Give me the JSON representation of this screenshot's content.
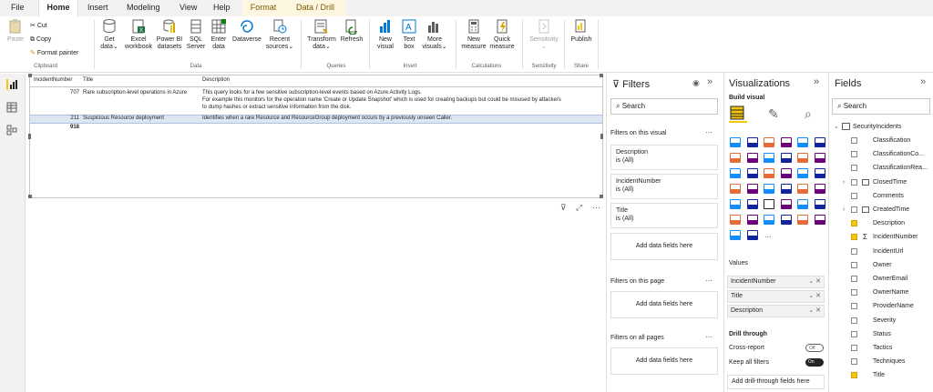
{
  "menu": {
    "file": "File",
    "home": "Home",
    "insert": "Insert",
    "modeling": "Modeling",
    "view": "View",
    "help": "Help",
    "format": "Format",
    "data_drill": "Data / Drill"
  },
  "ribbon": {
    "paste": "Paste",
    "cut": "Cut",
    "copy": "Copy",
    "format_painter": "Format painter",
    "clipboard": "Clipboard",
    "get_data_1": "Get",
    "get_data_2": "data",
    "excel_1": "Excel",
    "excel_2": "workbook",
    "pbi_1": "Power BI",
    "pbi_2": "datasets",
    "sql_1": "SQL",
    "sql_2": "Server",
    "enter_1": "Enter",
    "enter_2": "data",
    "dataverse": "Dataverse",
    "recent_1": "Recent",
    "recent_2": "sources",
    "data_group": "Data",
    "transform_1": "Transform",
    "transform_2": "data",
    "refresh": "Refresh",
    "queries": "Queries",
    "newvisual_1": "New",
    "newvisual_2": "visual",
    "textbox_1": "Text",
    "textbox_2": "box",
    "more_1": "More",
    "more_2": "visuals",
    "insert_group": "Insert",
    "newmeasure_1": "New",
    "newmeasure_2": "measure",
    "quick_1": "Quick",
    "quick_2": "measure",
    "calc_group": "Calculations",
    "sensitivity": "Sensitivity",
    "sensitivity_group": "Sensitivity",
    "publish": "Publish",
    "share": "Share"
  },
  "table": {
    "headers": [
      "IncidentNumber",
      "Title",
      "Description"
    ],
    "rows": [
      {
        "num": "707",
        "title": "Rare subscription-level operations in Azure",
        "desc1": "This query looks for a few sensitive subscription-level events based on Azure Activity Logs.",
        "desc2": "For example this monitors for the operation name 'Create or Update Snapshot' which is used for creating backups but could be misused by attackers",
        "desc3": "to dump hashes or extract sensitive information from the disk."
      },
      {
        "num": "211",
        "title": "Suspicious Resource deployment",
        "desc1": "Identifies when a rare Resource and ResourceGroup deployment occurs by a previously unseen Caller."
      }
    ],
    "total": "918"
  },
  "filters": {
    "title": "Filters",
    "search": "Search",
    "on_visual": "Filters on this visual",
    "cards": [
      {
        "name": "Description",
        "value": "is (All)"
      },
      {
        "name": "IncidentNumber",
        "value": "is (All)"
      },
      {
        "name": "Title",
        "value": "is (All)"
      }
    ],
    "add": "Add data fields here",
    "on_page": "Filters on this page",
    "on_all": "Filters on all pages"
  },
  "viz": {
    "title": "Visualizations",
    "build": "Build visual",
    "values": "Values",
    "wells": [
      "IncidentNumber",
      "Title",
      "Description"
    ],
    "drill": "Drill through",
    "cross": "Cross-report",
    "cross_state": "Off",
    "keep": "Keep all filters",
    "keep_state": "On",
    "add_drill": "Add drill-through fields here",
    "more": "..."
  },
  "fields": {
    "title": "Fields",
    "search": "Search",
    "table": "SecurityIncidents",
    "items": [
      {
        "name": "Classification",
        "checked": false
      },
      {
        "name": "ClassificationCo...",
        "checked": false
      },
      {
        "name": "ClassificationRea...",
        "checked": false
      },
      {
        "name": "ClosedTime",
        "checked": false
      },
      {
        "name": "Comments",
        "checked": false
      },
      {
        "name": "CreatedTime",
        "checked": false
      },
      {
        "name": "Description",
        "checked": true
      },
      {
        "name": "IncidentNumber",
        "checked": true
      },
      {
        "name": "IncidentUrl",
        "checked": false
      },
      {
        "name": "Owner",
        "checked": false
      },
      {
        "name": "OwnerEmail",
        "checked": false
      },
      {
        "name": "OwnerName",
        "checked": false
      },
      {
        "name": "ProviderName",
        "checked": false
      },
      {
        "name": "Severity",
        "checked": false
      },
      {
        "name": "Status",
        "checked": false
      },
      {
        "name": "Tactics",
        "checked": false
      },
      {
        "name": "Techniques",
        "checked": false
      },
      {
        "name": "Title",
        "checked": true
      }
    ]
  },
  "colors": {
    "accent": "#f2c811",
    "brand_text": "#252423",
    "selected_row": "#dde7f3"
  }
}
